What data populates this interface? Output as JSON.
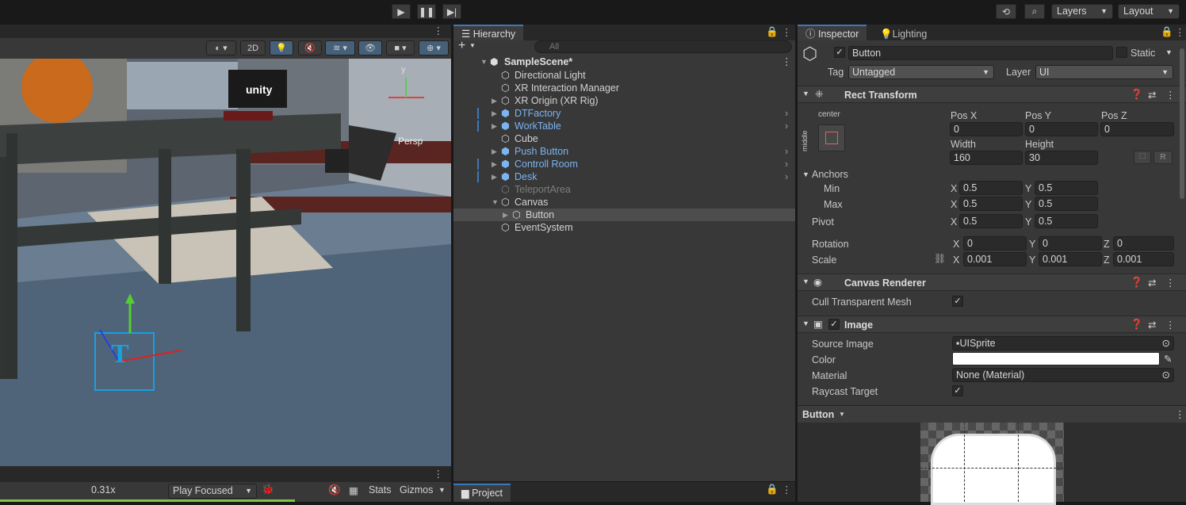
{
  "toolbar": {
    "layers": "Layers",
    "layout": "Layout"
  },
  "scene": {
    "mode_2d": "2D",
    "persp": "Persp",
    "axis_y": "y",
    "unity_label": "unity",
    "zoom": "0.31x",
    "play_focused": "Play Focused",
    "stats": "Stats",
    "gizmos": "Gizmos"
  },
  "hierarchy": {
    "tab": "Hierarchy",
    "search_placeholder": "All",
    "scene_name": "SampleScene*",
    "items": [
      {
        "label": "Directional Light"
      },
      {
        "label": "XR Interaction Manager"
      },
      {
        "label": "XR Origin (XR Rig)"
      },
      {
        "label": "DTFactory"
      },
      {
        "label": "WorkTable"
      },
      {
        "label": "Cube"
      },
      {
        "label": "Push Button"
      },
      {
        "label": "Controll Room"
      },
      {
        "label": "Desk"
      },
      {
        "label": "TeleportArea"
      },
      {
        "label": "Canvas"
      },
      {
        "label": "Button"
      },
      {
        "label": "EventSystem"
      }
    ],
    "project_tab": "Project"
  },
  "inspector": {
    "tab": "Inspector",
    "lighting_tab": "Lighting",
    "object_name": "Button",
    "static_label": "Static",
    "tag_label": "Tag",
    "tag_value": "Untagged",
    "layer_label": "Layer",
    "layer_value": "UI",
    "rect_transform": {
      "title": "Rect Transform",
      "anchor_h": "center",
      "anchor_v": "middle",
      "posx_label": "Pos X",
      "posx": "0",
      "posy_label": "Pos Y",
      "posy": "0",
      "posz_label": "Pos Z",
      "posz": "0",
      "width_label": "Width",
      "width": "160",
      "height_label": "Height",
      "height": "30",
      "r_button": "R",
      "anchors_label": "Anchors",
      "min_label": "Min",
      "min_x": "0.5",
      "min_y": "0.5",
      "max_label": "Max",
      "max_x": "0.5",
      "max_y": "0.5",
      "pivot_label": "Pivot",
      "pivot_x": "0.5",
      "pivot_y": "0.5",
      "rotation_label": "Rotation",
      "rot_x": "0",
      "rot_y": "0",
      "rot_z": "0",
      "scale_label": "Scale",
      "scale_x": "0.001",
      "scale_y": "0.001",
      "scale_z": "0.001",
      "x": "X",
      "y": "Y",
      "z": "Z"
    },
    "canvas_renderer": {
      "title": "Canvas Renderer",
      "cull_label": "Cull Transparent Mesh"
    },
    "image": {
      "title": "Image",
      "source_label": "Source Image",
      "source_value": "UISprite",
      "color_label": "Color",
      "color_value": "#ffffff",
      "material_label": "Material",
      "material_value": "None (Material)",
      "raycast_label": "Raycast Target"
    },
    "preview_label": "Button"
  },
  "colors": {
    "accent": "#3a79bb",
    "selection": "#4d4d4d",
    "prefab": "#7bb4f0"
  }
}
